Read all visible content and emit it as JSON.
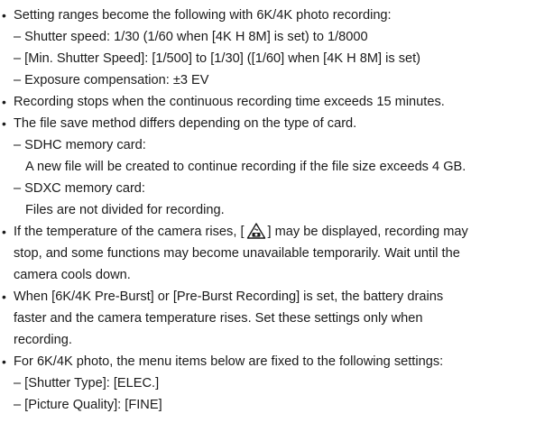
{
  "bullet_glyph": "•",
  "lines": [
    {
      "kind": "bullet",
      "text": "Setting ranges become the following with 6K/4K photo recording:"
    },
    {
      "kind": "sub",
      "text": "– Shutter speed: 1/30 (1/60 when [4K H 8M] is set) to 1/8000"
    },
    {
      "kind": "sub",
      "text": "– [Min. Shutter Speed]: [1/500] to [1/30] ([1/60] when [4K H 8M] is set)"
    },
    {
      "kind": "sub",
      "text": "– Exposure compensation: ±3 EV"
    },
    {
      "kind": "bullet",
      "text": "Recording stops when the continuous recording time exceeds 15 minutes."
    },
    {
      "kind": "bullet",
      "text": "The file save method differs depending on the type of card."
    },
    {
      "kind": "sub",
      "text": "– SDHC memory card:"
    },
    {
      "kind": "subcont",
      "text": "A new file will be created to continue recording if the file size exceeds 4 GB."
    },
    {
      "kind": "sub",
      "text": "– SDXC memory card:"
    },
    {
      "kind": "subcont",
      "text": "Files are not divided for recording."
    },
    {
      "kind": "bullet-icon",
      "before": "If the temperature of the camera rises, [",
      "after": "] may be displayed, recording may",
      "icon": "temperature-warning-icon"
    },
    {
      "kind": "cont",
      "text": "stop, and some functions may become unavailable temporarily. Wait until the"
    },
    {
      "kind": "cont",
      "text": "camera cools down."
    },
    {
      "kind": "bullet",
      "text": "When [6K/4K Pre-Burst] or [Pre-Burst Recording] is set, the battery drains"
    },
    {
      "kind": "cont",
      "text": "faster and the camera temperature rises. Set these settings only when"
    },
    {
      "kind": "cont",
      "text": "recording."
    },
    {
      "kind": "bullet",
      "text": "For 6K/4K photo, the menu items below are fixed to the following settings:"
    },
    {
      "kind": "sub",
      "text": "– [Shutter Type]: [ELEC.]"
    },
    {
      "kind": "sub",
      "text": "– [Picture Quality]: [FINE]"
    }
  ]
}
